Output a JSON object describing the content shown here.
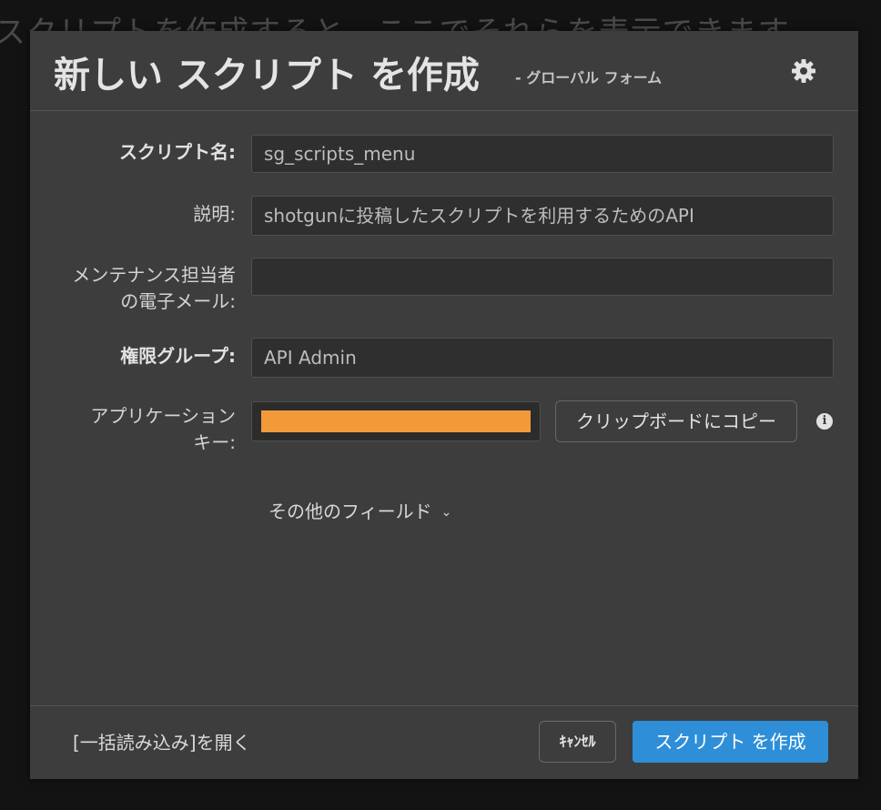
{
  "background": {
    "text": "スクリプトを作成すると、ここでそれらを表示できます。"
  },
  "dialog": {
    "title": "新しい スクリプト を作成",
    "subtitle": "- グローバル フォーム",
    "settings_icon": "gear-icon"
  },
  "form": {
    "script_name": {
      "label": "スクリプト名:",
      "value": "sg_scripts_menu"
    },
    "description": {
      "label": "説明:",
      "value": "shotgunに投稿したスクリプトを利用するためのAPI"
    },
    "maintainer_email": {
      "label_line1": "メンテナンス担当者",
      "label_line2": "の電子メール:",
      "value": ""
    },
    "permission_group": {
      "label": "権限グループ:",
      "value": "API Admin"
    },
    "application_key": {
      "label_line1": "アプリケーション",
      "label_line2": "キー:",
      "redaction_color": "#f2993a",
      "copy_button": "クリップボードにコピー",
      "info_icon": "info-icon"
    },
    "more_fields": "その他のフィールド",
    "more_fields_icon": "chevron-down-icon"
  },
  "footer": {
    "bulk_import_link": "[一括読み込み]を開く",
    "cancel_button": "ｷｬﾝｾﾙ",
    "create_button": "スクリプト を作成",
    "create_button_color": "#2e8fd8"
  }
}
